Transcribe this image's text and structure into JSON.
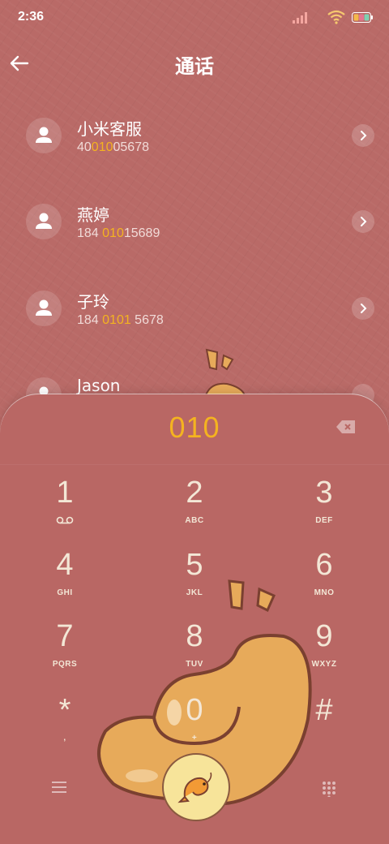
{
  "status": {
    "time": "2:36"
  },
  "header": {
    "title": "通话"
  },
  "contacts": [
    {
      "name": "小米客服",
      "num_pre": "40",
      "num_hl": "010",
      "num_post": "05678"
    },
    {
      "name": "燕婷",
      "num_pre": "184 ",
      "num_hl": "010",
      "num_post": "15689"
    },
    {
      "name": "子玲",
      "num_pre": "184 ",
      "num_hl": "0101",
      "num_post": " 5678"
    },
    {
      "name": "Jason",
      "num_pre": "",
      "num_hl": "",
      "num_post": ""
    }
  ],
  "dialer": {
    "number": "010",
    "keys": [
      {
        "digit": "1",
        "letters": ""
      },
      {
        "digit": "2",
        "letters": "ABC"
      },
      {
        "digit": "3",
        "letters": "DEF"
      },
      {
        "digit": "4",
        "letters": "GHI"
      },
      {
        "digit": "5",
        "letters": "JKL"
      },
      {
        "digit": "6",
        "letters": "MNO"
      },
      {
        "digit": "7",
        "letters": "PQRS"
      },
      {
        "digit": "8",
        "letters": "TUV"
      },
      {
        "digit": "9",
        "letters": "WXYZ"
      },
      {
        "digit": "*",
        "letters": ","
      },
      {
        "digit": "0",
        "letters": "+"
      },
      {
        "digit": "#",
        "letters": ""
      }
    ]
  },
  "colors": {
    "accent": "#f4b320",
    "background": "#b96a67",
    "text": "#ffffff"
  },
  "icons": {
    "back": "arrow-left-icon",
    "avatar": "person-icon",
    "chevron": "chevron-right-icon",
    "delete": "backspace-icon",
    "voicemail": "voicemail-icon",
    "menu": "menu-icon",
    "keypad": "keypad-icon",
    "call": "shrimp-call-icon"
  }
}
